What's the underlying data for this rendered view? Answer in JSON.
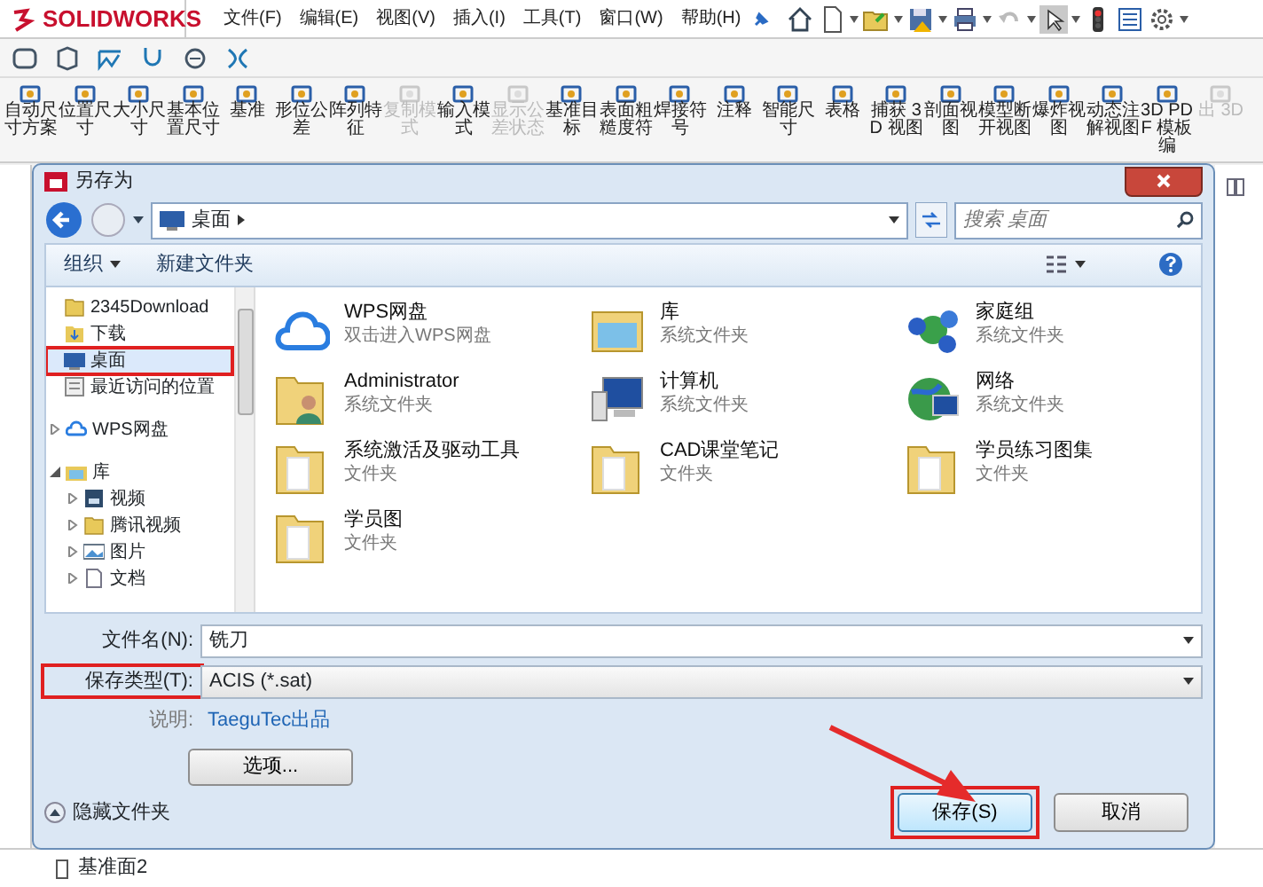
{
  "app": {
    "logo": "SOLIDWORKS",
    "menu": [
      "文件(F)",
      "编辑(E)",
      "视图(V)",
      "插入(I)",
      "工具(T)",
      "窗口(W)",
      "帮助(H)"
    ]
  },
  "command_toolbar": [
    {
      "label": "自动尺寸方案",
      "disabled": false
    },
    {
      "label": "位置尺寸",
      "disabled": false
    },
    {
      "label": "大小尺寸",
      "disabled": false
    },
    {
      "label": "基本位置尺寸",
      "disabled": false
    },
    {
      "label": "基准",
      "disabled": false
    },
    {
      "label": "形位公差",
      "disabled": false
    },
    {
      "label": "阵列特征",
      "disabled": false
    },
    {
      "label": "复制模式",
      "disabled": true
    },
    {
      "label": "输入模式",
      "disabled": false
    },
    {
      "label": "显示公差状态",
      "disabled": true
    },
    {
      "label": "基准目标",
      "disabled": false
    },
    {
      "label": "表面粗糙度符",
      "disabled": false
    },
    {
      "label": "焊接符号",
      "disabled": false
    },
    {
      "label": "注释",
      "disabled": false
    },
    {
      "label": "智能尺寸",
      "disabled": false
    },
    {
      "label": "表格",
      "disabled": false
    },
    {
      "label": "捕获 3D 视图",
      "disabled": false
    },
    {
      "label": "剖面视图",
      "disabled": false
    },
    {
      "label": "模型断开视图",
      "disabled": false
    },
    {
      "label": "爆炸视图",
      "disabled": false
    },
    {
      "label": "动态注解视图",
      "disabled": false
    },
    {
      "label": "3D PDF 模板编",
      "disabled": false
    },
    {
      "label": "出 3D",
      "disabled": true
    }
  ],
  "dialog": {
    "title": "另存为",
    "path": "桌面",
    "search_placeholder": "搜索 桌面",
    "organize": "组织",
    "new_folder": "新建文件夹",
    "nav": [
      {
        "label": "2345Download",
        "kind": "folder",
        "selected": false,
        "highlighted": false
      },
      {
        "label": "下载",
        "kind": "download",
        "selected": false,
        "highlighted": false
      },
      {
        "label": "桌面",
        "kind": "desktop",
        "selected": true,
        "highlighted": true
      },
      {
        "label": "最近访问的位置",
        "kind": "recent",
        "selected": false,
        "highlighted": false
      },
      {
        "label": "WPS网盘",
        "kind": "cloud",
        "selected": false,
        "highlighted": false,
        "expanded": false
      },
      {
        "label": "库",
        "kind": "library",
        "selected": false,
        "highlighted": false,
        "expanded": true,
        "children": [
          {
            "label": "视频",
            "kind": "video",
            "selected": false,
            "highlighted": false,
            "expanded": false
          },
          {
            "label": "腾讯视频",
            "kind": "folder",
            "selected": false,
            "highlighted": false,
            "expanded": false
          },
          {
            "label": "图片",
            "kind": "picture",
            "selected": false,
            "highlighted": false,
            "expanded": false
          },
          {
            "label": "文档",
            "kind": "document",
            "selected": false,
            "highlighted": false,
            "expanded": false
          }
        ]
      }
    ],
    "files": [
      {
        "name": "WPS网盘",
        "type": "双击进入WPS网盘",
        "kind": "cloud"
      },
      {
        "name": "库",
        "type": "系统文件夹",
        "kind": "library"
      },
      {
        "name": "家庭组",
        "type": "系统文件夹",
        "kind": "homegroup"
      },
      {
        "name": "Administrator",
        "type": "系统文件夹",
        "kind": "user"
      },
      {
        "name": "计算机",
        "type": "系统文件夹",
        "kind": "computer"
      },
      {
        "name": "网络",
        "type": "系统文件夹",
        "kind": "network"
      },
      {
        "name": "系统激活及驱动工具",
        "type": "文件夹",
        "kind": "folder"
      },
      {
        "name": "CAD课堂笔记",
        "type": "文件夹",
        "kind": "folder"
      },
      {
        "name": "学员练习图集",
        "type": "文件夹",
        "kind": "folder"
      },
      {
        "name": "学员图",
        "type": "文件夹",
        "kind": "folder"
      }
    ],
    "filename_label": "文件名(N):",
    "filename": "铣刀",
    "type_label": "保存类型(T):",
    "type_label_highlighted": true,
    "save_type": "ACIS (*.sat)",
    "note_label": "说明:",
    "note": "TaeguTec出品",
    "options_button": "选项...",
    "hide_folders": "隐藏文件夹",
    "buttons": [
      {
        "label": "保存(S)",
        "kind": "primary",
        "highlighted": true
      },
      {
        "label": "取消",
        "kind": "secondary",
        "highlighted": false
      }
    ]
  },
  "feature_tree": {
    "item": "基准面2"
  }
}
